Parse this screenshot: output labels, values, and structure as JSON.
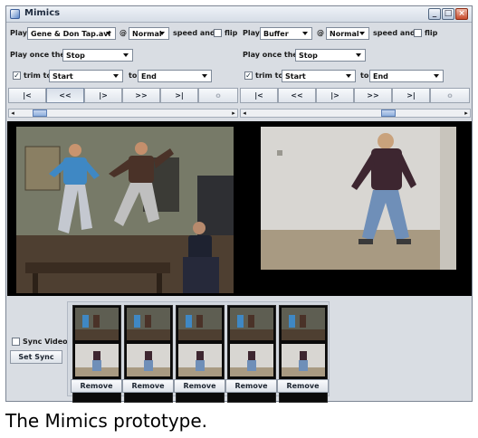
{
  "window": {
    "title": "Mimics"
  },
  "left_panel": {
    "play_label": "Play",
    "source": "Gene & Don Tap.avi",
    "at_label": "@",
    "speed": "Normal",
    "speed_label": "speed and",
    "flip_label": "flip",
    "flip_checked": false,
    "play_once_label": "Play once then",
    "then_action": "Stop",
    "trim_label": "trim to",
    "trim_checked": true,
    "trim_start": "Start",
    "to_label": "to",
    "trim_end": "End",
    "transport": [
      "|<",
      "<<",
      "|>",
      ">>",
      ">|",
      "o"
    ]
  },
  "right_panel": {
    "play_label": "Play",
    "source": "Buffer",
    "at_label": "@",
    "speed": "Normal",
    "speed_label": "speed and",
    "flip_label": "flip",
    "flip_checked": false,
    "play_once_label": "Play once then",
    "then_action": "Stop",
    "trim_label": "trim to",
    "trim_checked": true,
    "trim_start": "Start",
    "to_label": "to",
    "trim_end": "End",
    "transport": [
      "|<",
      "<<",
      "|>",
      ">>",
      ">|",
      "o"
    ]
  },
  "sync": {
    "sync_video_label": "Sync Video",
    "sync_video_checked": false,
    "set_sync_label": "Set Sync"
  },
  "recordings": {
    "remove_label": "Remove",
    "count": 5
  },
  "caption": "The Mimics prototype.",
  "colors": {
    "window_bg": "#d9dde3",
    "video_bg": "#000000",
    "scroll_thumb": "#8fb0de"
  }
}
